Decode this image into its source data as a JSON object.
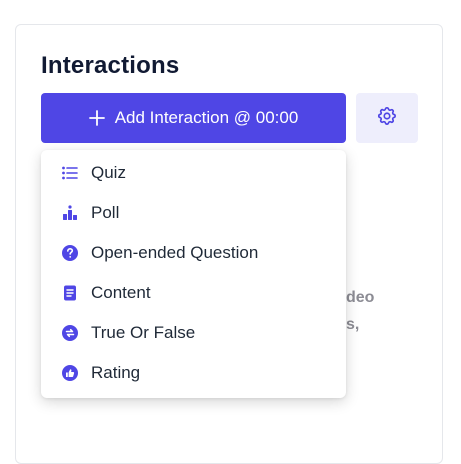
{
  "panel": {
    "title": "Interactions",
    "add_button_label": "Add Interaction @ 00:00",
    "background_text_line1": "deo",
    "background_text_line2": "s,"
  },
  "menu": {
    "items": [
      {
        "label": "Quiz",
        "icon": "list-icon"
      },
      {
        "label": "Poll",
        "icon": "poll-icon"
      },
      {
        "label": "Open-ended Question",
        "icon": "question-circle-icon"
      },
      {
        "label": "Content",
        "icon": "document-icon"
      },
      {
        "label": "True Or False",
        "icon": "true-false-icon"
      },
      {
        "label": "Rating",
        "icon": "thumbs-up-icon"
      }
    ]
  },
  "colors": {
    "accent": "#4f46e5",
    "accent_light": "#eeeefc",
    "title": "#111a33",
    "muted_text": "#8c8c94"
  }
}
